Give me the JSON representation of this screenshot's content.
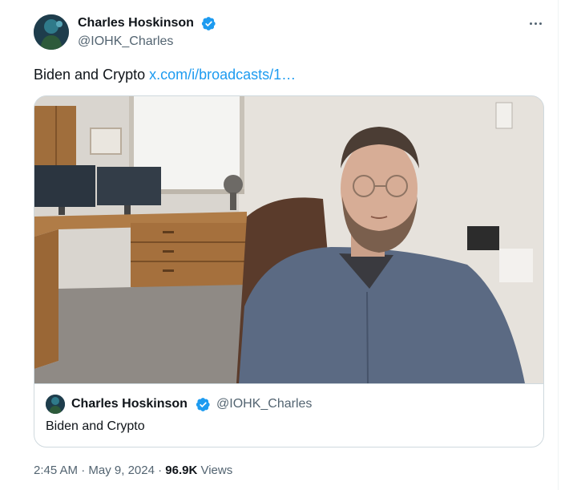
{
  "tweet": {
    "author_name": "Charles Hoskinson",
    "author_handle": "@IOHK_Charles",
    "verified_icon": "verified-badge-icon",
    "more_icon": "more-options-icon",
    "text": "Biden and Crypto",
    "link_text": "x.com/i/broadcasts/1…"
  },
  "card": {
    "author_name": "Charles Hoskinson",
    "author_handle": "@IOHK_Charles",
    "title": "Biden and Crypto"
  },
  "meta": {
    "time": "2:45 AM",
    "separator1": " · ",
    "date": "May 9, 2024",
    "separator2": " · ",
    "views_count": "96.9K",
    "views_label": " Views"
  },
  "colors": {
    "link": "#1d9bf0",
    "verified": "#1d9bf0",
    "secondary_text": "#536471",
    "border": "#cfd9de"
  }
}
